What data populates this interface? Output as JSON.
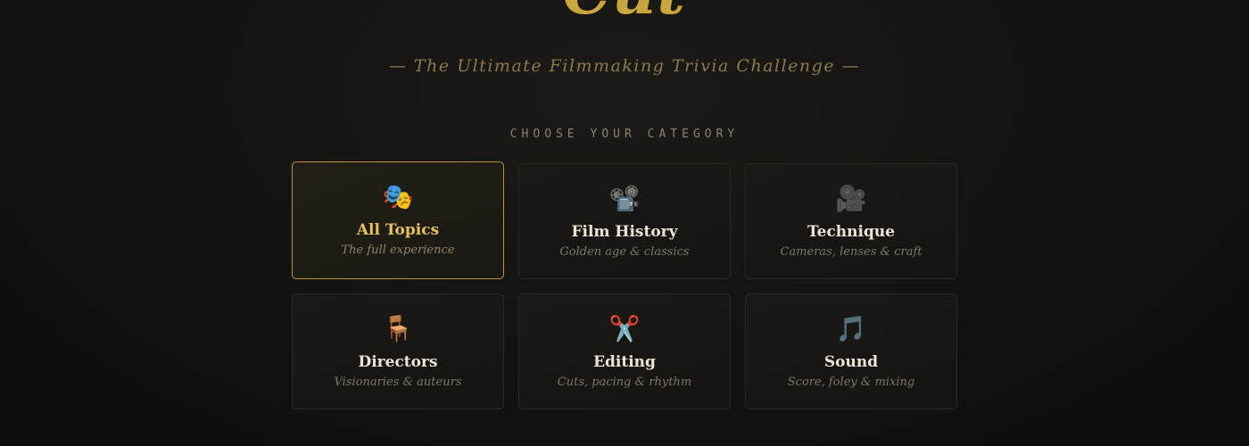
{
  "header": {
    "title": "Cut",
    "tagline": "— The Ultimate Filmmaking Trivia Challenge —"
  },
  "categories_section": {
    "label": "CHOOSE YOUR CATEGORY",
    "selected": "All Topics",
    "items": [
      {
        "icon": "🎭",
        "icon_name": "theater-masks-icon",
        "title": "All Topics",
        "description": "The full experience"
      },
      {
        "icon": "📽️",
        "icon_name": "film-projector-icon",
        "title": "Film History",
        "description": "Golden age & classics"
      },
      {
        "icon": "🎥",
        "icon_name": "movie-camera-icon",
        "title": "Technique",
        "description": "Cameras, lenses & craft"
      },
      {
        "icon": "🪑",
        "icon_name": "directors-chair-icon",
        "title": "Directors",
        "description": "Visionaries & auteurs"
      },
      {
        "icon": "✂️",
        "icon_name": "scissors-icon",
        "title": "Editing",
        "description": "Cuts, pacing & rhythm"
      },
      {
        "icon": "🎵",
        "icon_name": "music-note-icon",
        "title": "Sound",
        "description": "Score, foley & mixing"
      }
    ]
  },
  "colors": {
    "accent_gold": "#c9a640",
    "selected_border": "#b89537",
    "background": "#121210"
  }
}
